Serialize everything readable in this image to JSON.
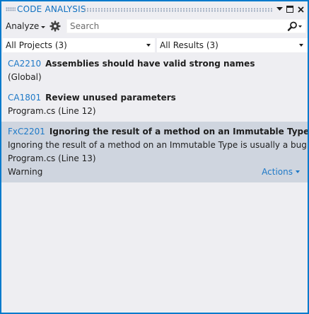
{
  "window": {
    "title": "CODE ANALYSIS"
  },
  "toolbar": {
    "analyze_label": "Analyze",
    "search_placeholder": "Search",
    "search_value": ""
  },
  "filters": {
    "projects": "All Projects (3)",
    "results": "All Results (3)"
  },
  "results": [
    {
      "code": "CA2210",
      "title": "Assemblies should have valid strong names",
      "location": "(Global)"
    },
    {
      "code": "CA1801",
      "title": "Review unused parameters",
      "location": "Program.cs (Line 12)"
    },
    {
      "code": "FxC2201",
      "title": "Ignoring the result of a method on an Immutable Type is usually a bug",
      "description": "Ignoring the result of a method on an Immutable Type is usually a bug",
      "location": "Program.cs (Line 13)",
      "severity": "Warning",
      "actions_label": "Actions"
    }
  ],
  "colors": {
    "accent": "#007acc",
    "link": "#1e79c7",
    "selection": "#cfd5df",
    "background": "#eeeef2"
  },
  "icons": {
    "settings": "gear-icon",
    "search": "search-icon",
    "dropdown": "chevron-down-icon",
    "pin": "pin-icon",
    "maximize": "maximize-icon",
    "close": "close-icon"
  }
}
